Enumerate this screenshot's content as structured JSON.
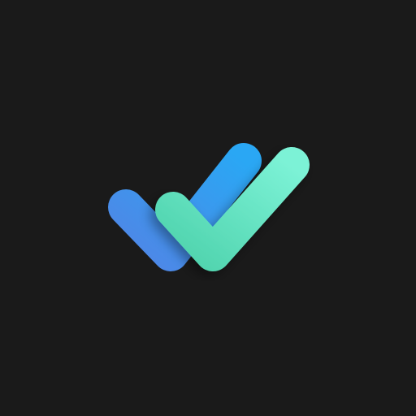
{
  "app_icon": {
    "icon": "double-check-icon",
    "background_color": "#1a1a1a",
    "back_check_gradient": [
      "#2aa7f4",
      "#4f86e6"
    ],
    "front_check_gradient": [
      "#4fd3ad",
      "#7cf2d6"
    ]
  }
}
